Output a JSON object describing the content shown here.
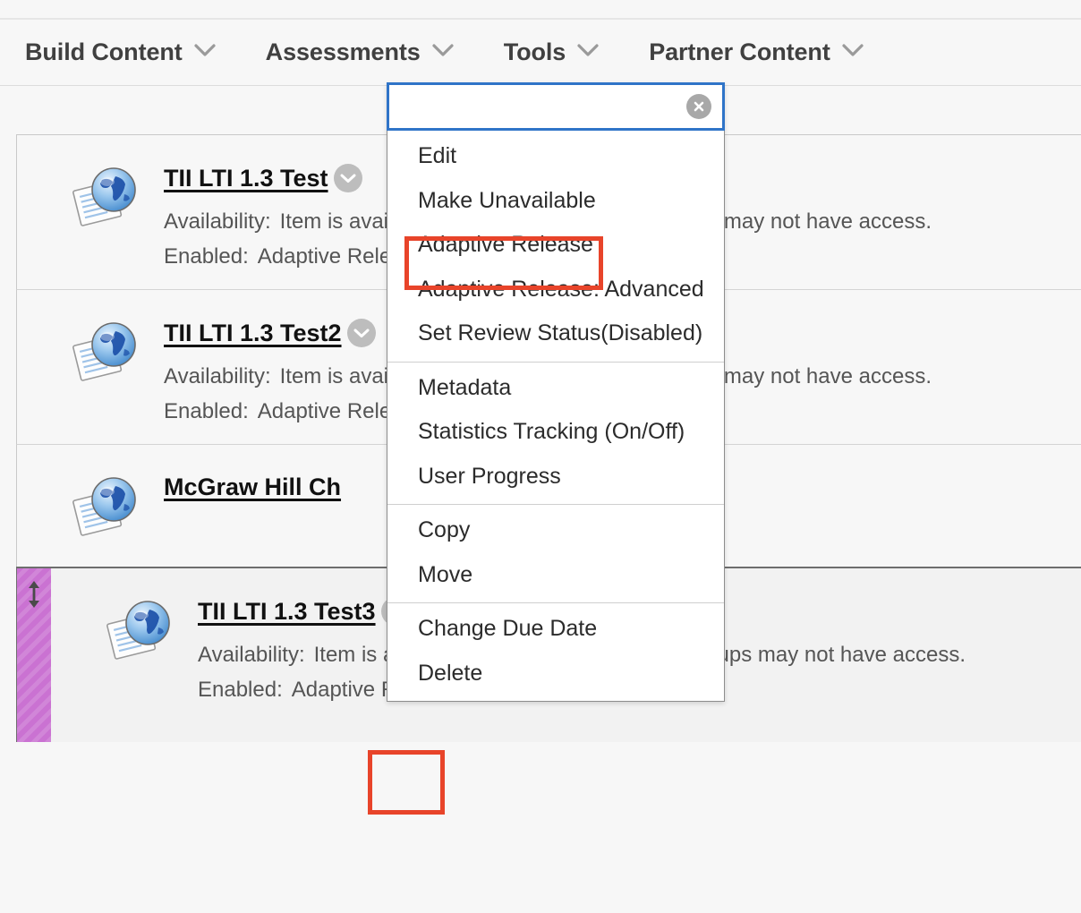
{
  "colors": {
    "page_background": "#f7f7f7",
    "focus_border_blue": "#2f74c8",
    "highlight_red": "#e8442a",
    "drag_handle_purple": "#ca72d2",
    "title_text": "#111111",
    "meta_text": "#555555"
  },
  "action_bar": {
    "items": [
      {
        "label": "Build Content",
        "icon": "chevron-down-icon"
      },
      {
        "label": "Assessments",
        "icon": "chevron-down-icon"
      },
      {
        "label": "Tools",
        "icon": "chevron-down-icon"
      },
      {
        "label": "Partner Content",
        "icon": "chevron-down-icon"
      }
    ]
  },
  "context_menu": {
    "search": {
      "value": "",
      "placeholder": "",
      "clear_icon": "clear-circle-x-icon"
    },
    "groups": [
      {
        "items": [
          {
            "label": "Edit",
            "highlighted": false
          },
          {
            "label": "Make Unavailable",
            "highlighted": false
          },
          {
            "label": "Adaptive Release",
            "highlighted": true
          },
          {
            "label": "Adaptive Release: Advanced",
            "highlighted": false
          },
          {
            "label": "Set Review Status(Disabled)",
            "highlighted": false
          }
        ]
      },
      {
        "items": [
          {
            "label": "Metadata",
            "highlighted": false
          },
          {
            "label": "Statistics Tracking (On/Off)",
            "highlighted": false
          },
          {
            "label": "User Progress",
            "highlighted": false
          }
        ]
      },
      {
        "items": [
          {
            "label": "Copy",
            "highlighted": false
          },
          {
            "label": "Move",
            "highlighted": false
          }
        ]
      },
      {
        "items": [
          {
            "label": "Change Due Date",
            "highlighted": false
          },
          {
            "label": "Delete",
            "highlighted": false
          }
        ]
      }
    ]
  },
  "content_list": {
    "rows": [
      {
        "title": "TII LTI 1.3 Test",
        "icon": "lti-content-globe-document-icon",
        "caret_icon": "chevron-down-circle-icon",
        "availability_label": "Availability:",
        "availability_value": "Item is available, but some students or groups may not have access.",
        "enabled_label": "Enabled:",
        "enabled_value": "Adaptive Release",
        "selected": false,
        "has_drag_handle": false
      },
      {
        "title": "TII LTI 1.3 Test2",
        "icon": "lti-content-globe-document-icon",
        "caret_icon": "chevron-down-circle-icon",
        "availability_label": "Availability:",
        "availability_value": "Item is available, but some students or groups may not have access.",
        "enabled_label": "Enabled:",
        "enabled_value": "Adaptive Release",
        "selected": false,
        "has_drag_handle": false
      },
      {
        "title": "McGraw Hill Ch",
        "icon": "lti-content-globe-document-icon",
        "caret_icon": "chevron-down-circle-icon",
        "availability_label": "",
        "availability_value": "",
        "enabled_label": "",
        "enabled_value": "",
        "selected": false,
        "has_drag_handle": false
      },
      {
        "title": "TII LTI 1.3 Test3",
        "icon": "lti-content-globe-document-icon",
        "caret_icon": "chevron-down-circle-icon",
        "availability_label": "Availability:",
        "availability_value": "Item is available, but some students or groups may not have access.",
        "enabled_label": "Enabled:",
        "enabled_value": "Adaptive Release",
        "selected": true,
        "has_drag_handle": true,
        "drag_handle_icon": "move-up-down-arrow-icon"
      }
    ]
  }
}
